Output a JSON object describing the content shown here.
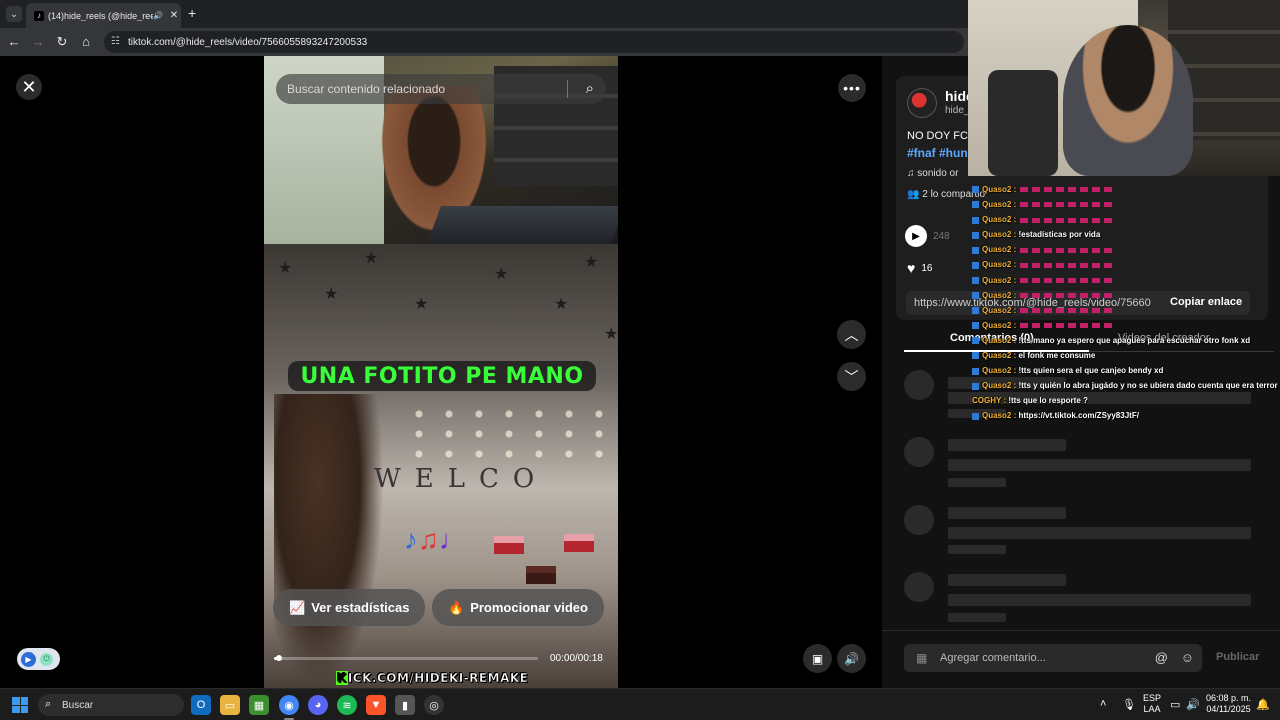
{
  "browser": {
    "tab_title": "(14)hide_reels (@hide_reels",
    "tab_close": "✕",
    "new_tab": "+",
    "url": "tiktok.com/@hide_reels/video/7566055893247200533"
  },
  "video": {
    "search_placeholder": "Buscar contenido relacionado",
    "caption": "UNA FOTITO PE MANO",
    "scene_text": "WELCO",
    "stats_button": "Ver estadísticas",
    "promote_button": "Promocionar video",
    "timecode": "00:00/00:18",
    "progress": 0.02,
    "kick_overlay": "KICK.COM/HIDEKI-REMAKE"
  },
  "post": {
    "username": "hide",
    "handle": "hide_",
    "description": "NO DOY FC",
    "hashtags": "#fnaf #hun",
    "sound": "sonido or",
    "shared": "2 lo compartio",
    "plays": "248",
    "likes": "16",
    "link": "https://www.tiktok.com/@hide_reels/video/75660",
    "copy_link": "Copiar enlace",
    "tab_comments": "Comentarios (0)",
    "tab_creator": "Videos del creador",
    "comment_placeholder": "Agregar comentario...",
    "publish": "Publicar"
  },
  "chat": [
    {
      "user": "Quaso2",
      "text": ""
    },
    {
      "user": "Quaso2",
      "text": ""
    },
    {
      "user": "Quaso2",
      "text": ""
    },
    {
      "user": "Quaso2",
      "text": "!estadísticas por vida"
    },
    {
      "user": "Quaso2",
      "text": ""
    },
    {
      "user": "Quaso2",
      "text": ""
    },
    {
      "user": "Quaso2",
      "text": ""
    },
    {
      "user": "Quaso2",
      "text": ""
    },
    {
      "user": "Quaso2",
      "text": ""
    },
    {
      "user": "Quaso2",
      "text": ""
    },
    {
      "user": "Quaso2",
      "text": "!tts mano ya espero que apagues para escuchar otro fonk xd"
    },
    {
      "user": "Quaso2",
      "text": "el fonk me consume"
    },
    {
      "user": "Quaso2",
      "text": "!tts quien sera el que canjeo bendy xd"
    },
    {
      "user": "Quaso2",
      "text": "!tts y quién lo abra jugádo y no se ubiera dado cuenta que era terror xd"
    },
    {
      "user": "COGHY",
      "text": "!tts que lo resporte ?"
    },
    {
      "user": "Quaso2",
      "text": "https://vt.tiktok.com/ZSyy83JtF/"
    }
  ],
  "taskbar": {
    "search": "Buscar",
    "lang1": "ESP",
    "lang2": "LAA",
    "time": "06:08 p. m.",
    "date": "04/11/2025"
  },
  "colors": {
    "caption_text": "#39ff3a",
    "kick_green": "#53fc18",
    "hashtag": "#5ba8ff",
    "chat_user": "#f0b23a"
  }
}
